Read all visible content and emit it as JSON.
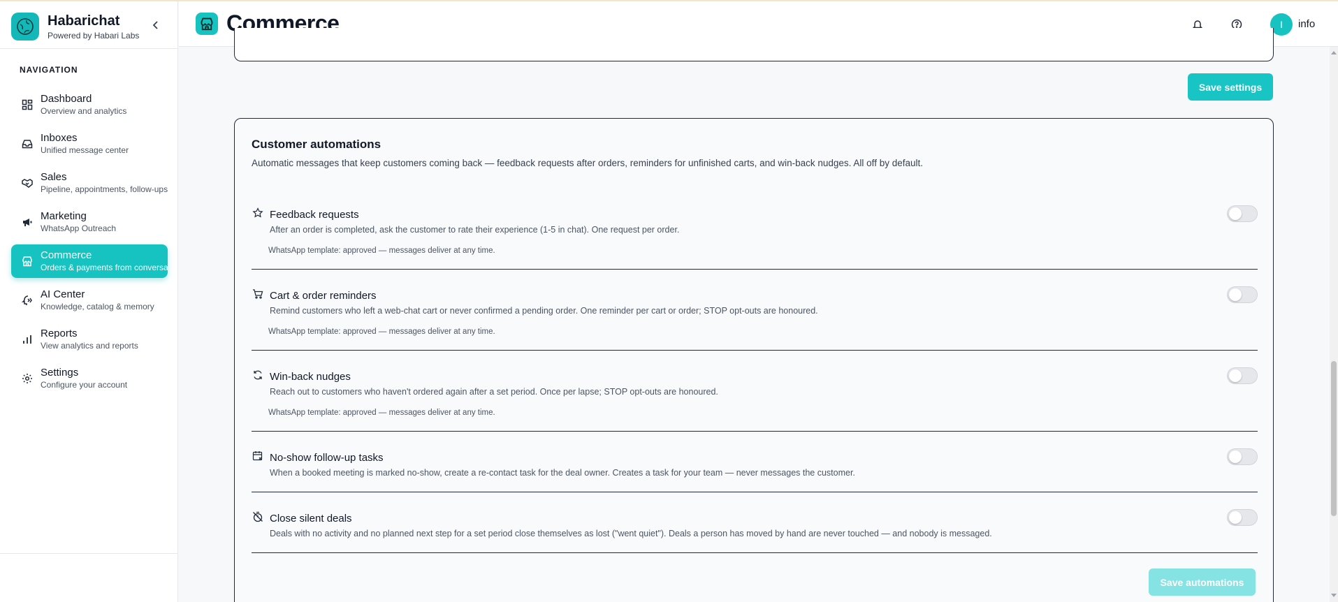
{
  "brand": {
    "name": "Habarichat",
    "tagline": "Powered by Habari Labs"
  },
  "sidebar": {
    "heading": "NAVIGATION",
    "items": [
      {
        "label": "Dashboard",
        "sub": "Overview and analytics",
        "icon": "grid-icon",
        "active": false
      },
      {
        "label": "Inboxes",
        "sub": "Unified message center",
        "icon": "inbox-icon",
        "active": false
      },
      {
        "label": "Sales",
        "sub": "Pipeline, appointments, follow-ups",
        "icon": "handshake-icon",
        "active": false
      },
      {
        "label": "Marketing",
        "sub": "WhatsApp Outreach",
        "icon": "megaphone-icon",
        "active": false
      },
      {
        "label": "Commerce",
        "sub": "Orders & payments from conversations",
        "icon": "store-icon",
        "active": true
      },
      {
        "label": "AI Center",
        "sub": "Knowledge, catalog & memory",
        "icon": "ai-brain-icon",
        "active": false
      },
      {
        "label": "Reports",
        "sub": "View analytics and reports",
        "icon": "bar-chart-icon",
        "active": false
      },
      {
        "label": "Settings",
        "sub": "Configure your account",
        "icon": "gear-icon",
        "active": false
      }
    ]
  },
  "header": {
    "title": "Commerce",
    "user_initial": "I",
    "user_name": "info"
  },
  "buttons": {
    "save_settings": "Save settings",
    "save_automations": "Save automations"
  },
  "automations": {
    "title": "Customer automations",
    "description": "Automatic messages that keep customers coming back — feedback requests after orders, reminders for unfinished carts, and win-back nudges. All off by default.",
    "items": [
      {
        "icon": "star-icon",
        "title": "Feedback requests",
        "desc": "After an order is completed, ask the customer to rate their experience (1-5 in chat). One request per order.",
        "template": "WhatsApp template: approved — messages deliver at any time.",
        "enabled": false
      },
      {
        "icon": "cart-icon",
        "title": "Cart & order reminders",
        "desc": "Remind customers who left a web-chat cart or never confirmed a pending order. One reminder per cart or order; STOP opt-outs are honoured.",
        "template": "WhatsApp template: approved — messages deliver at any time.",
        "enabled": false
      },
      {
        "icon": "refresh-icon",
        "title": "Win-back nudges",
        "desc": "Reach out to customers who haven't ordered again after a set period. Once per lapse; STOP opt-outs are honoured.",
        "template": "WhatsApp template: approved — messages deliver at any time.",
        "enabled": false
      },
      {
        "icon": "calendar-x-icon",
        "title": "No-show follow-up tasks",
        "desc": "When a booked meeting is marked no-show, create a re-contact task for the deal owner. Creates a task for your team — never messages the customer.",
        "template": "",
        "enabled": false
      },
      {
        "icon": "timer-off-icon",
        "title": "Close silent deals",
        "desc": "Deals with no activity and no planned next step for a set period close themselves as lost (\"went quiet\"). Deals a person has moved by hand are never touched — and nobody is messaged.",
        "template": "",
        "enabled": false
      }
    ]
  },
  "colors": {
    "accent": "#17c3c0",
    "accent_disabled": "#86e3e3",
    "text": "#111827"
  }
}
